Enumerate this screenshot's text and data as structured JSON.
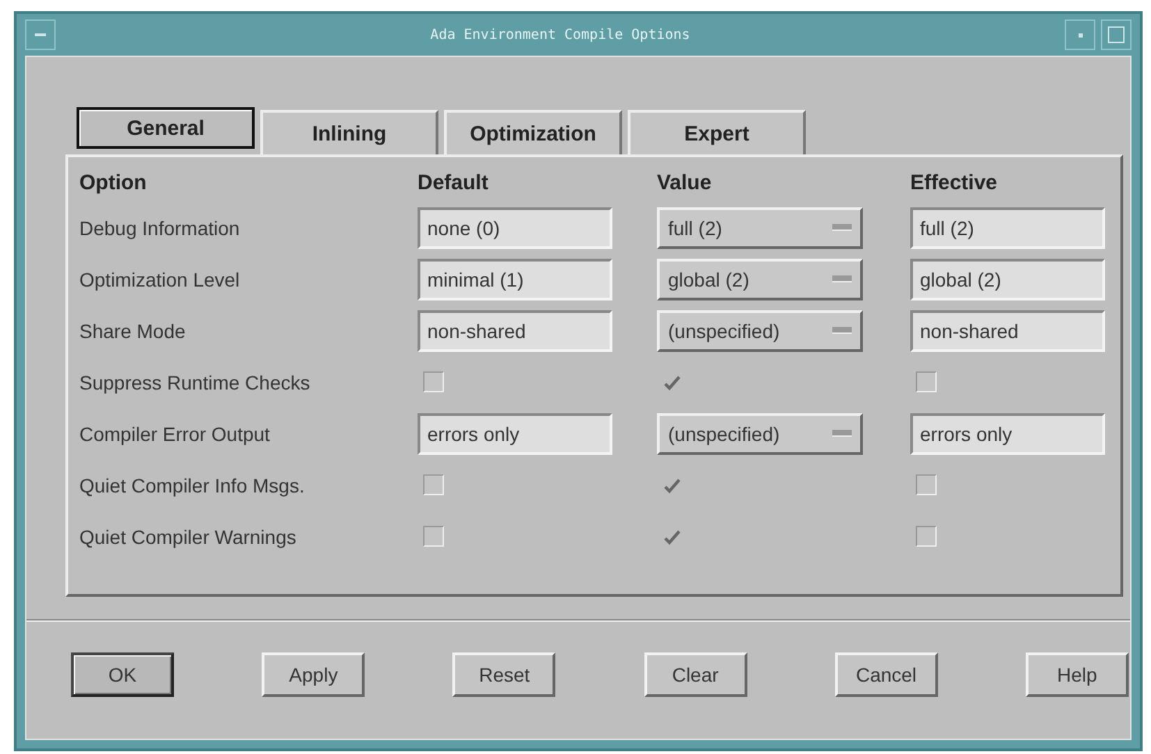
{
  "window": {
    "title": "Ada Environment Compile Options"
  },
  "tabs": [
    {
      "label": "General",
      "selected": true
    },
    {
      "label": "Inlining",
      "selected": false
    },
    {
      "label": "Optimization",
      "selected": false
    },
    {
      "label": "Expert",
      "selected": false
    }
  ],
  "table": {
    "columns": [
      "Option",
      "Default",
      "Value",
      "Effective"
    ],
    "rows": [
      {
        "kind": "field",
        "option": "Debug Information",
        "default": "none (0)",
        "value": "full (2)",
        "effective": "full (2)"
      },
      {
        "kind": "field",
        "option": "Optimization Level",
        "default": "minimal (1)",
        "value": "global (2)",
        "effective": "global (2)"
      },
      {
        "kind": "field",
        "option": "Share Mode",
        "default": "non-shared",
        "value": "(unspecified)",
        "effective": "non-shared"
      },
      {
        "kind": "check",
        "option": "Suppress Runtime Checks",
        "default_checked": false,
        "value_checked": true,
        "effective_checked": false
      },
      {
        "kind": "field",
        "option": "Compiler Error Output",
        "default": "errors only",
        "value": "(unspecified)",
        "effective": "errors only"
      },
      {
        "kind": "check",
        "option": "Quiet Compiler Info Msgs.",
        "default_checked": false,
        "value_checked": true,
        "effective_checked": false
      },
      {
        "kind": "check",
        "option": "Quiet Compiler Warnings",
        "default_checked": false,
        "value_checked": true,
        "effective_checked": false
      }
    ]
  },
  "buttons": [
    {
      "label": "OK",
      "default": true
    },
    {
      "label": "Apply",
      "default": false
    },
    {
      "label": "Reset",
      "default": false
    },
    {
      "label": "Clear",
      "default": false
    },
    {
      "label": "Cancel",
      "default": false
    },
    {
      "label": "Help",
      "default": false
    }
  ]
}
